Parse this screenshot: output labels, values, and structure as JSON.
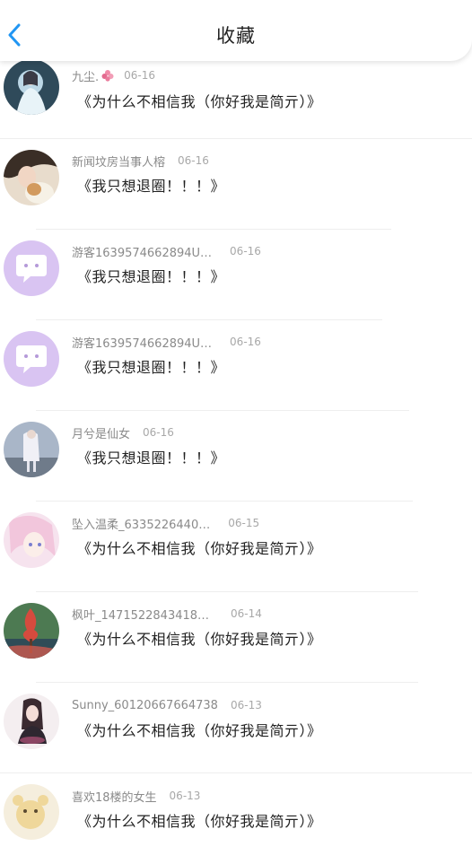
{
  "header": {
    "title": "收藏"
  },
  "items": [
    {
      "user": "九尘.",
      "date": "06-16",
      "text": "《为什么不相信我（你好我是简亓）》",
      "avatar": "avatar-1"
    },
    {
      "user": "新闻坟房当事人榕",
      "date": "06-16",
      "text": "《我只想退圈！！！》",
      "avatar": "avatar-2"
    },
    {
      "user": "游客1639574662894U…",
      "date": "06-16",
      "text": "《我只想退圈！！！》",
      "avatar": "default-chat-avatar"
    },
    {
      "user": "游客1639574662894U…",
      "date": "06-16",
      "text": "《我只想退圈！！！》",
      "avatar": "default-chat-avatar"
    },
    {
      "user": "月兮是仙女",
      "date": "06-16",
      "text": "《我只想退圈！！！》",
      "avatar": "avatar-5"
    },
    {
      "user": "坠入温柔_6335226440…",
      "date": "06-15",
      "text": "《为什么不相信我（你好我是简亓）》",
      "avatar": "avatar-6"
    },
    {
      "user": "枫叶_1471522843418…",
      "date": "06-14",
      "text": "《为什么不相信我（你好我是简亓）》",
      "avatar": "avatar-7"
    },
    {
      "user": "Sunny_60120667664738",
      "date": "06-13",
      "text": "《为什么不相信我（你好我是简亓）》",
      "avatar": "avatar-8"
    },
    {
      "user": "喜欢18楼的女生",
      "date": "06-13",
      "text": "《为什么不相信我（你好我是简亓）》",
      "avatar": "avatar-9"
    }
  ],
  "colors": {
    "accent": "#2196f3",
    "default_avatar_bg": "#d9c4f2",
    "text": "#222222",
    "meta": "#888888"
  }
}
